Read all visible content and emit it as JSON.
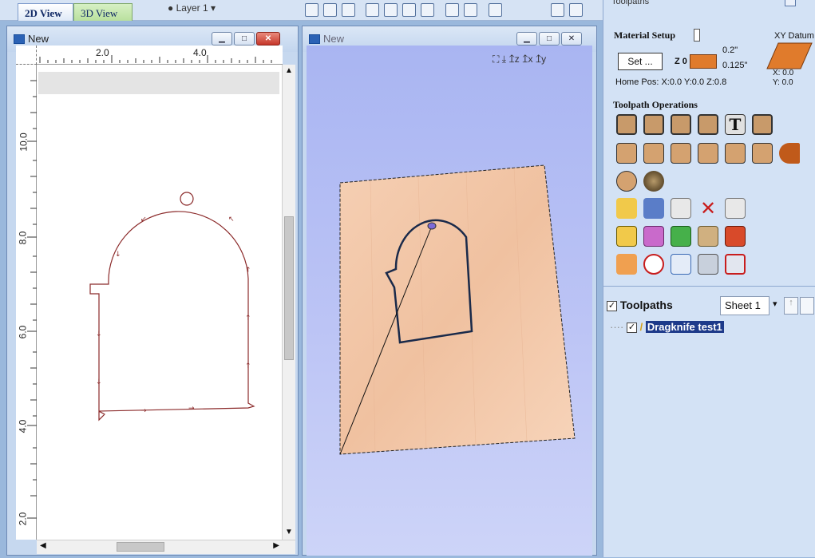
{
  "tabs": {
    "view2d": "2D View",
    "view3d": "3D View"
  },
  "layer_selector": "Layer 1",
  "window_2d": {
    "title": "New"
  },
  "window_3d": {
    "title": "New"
  },
  "ruler_top_labels": [
    "2.0",
    "4.0"
  ],
  "ruler_left_labels": [
    "10.0",
    "8.0",
    "6.0",
    "4.0",
    "2.0"
  ],
  "panel": {
    "header": "Toolpaths",
    "material_setup": "Material Setup",
    "set_button": "Set ...",
    "z_zero": "Z 0",
    "thickness_top": "0.2\"",
    "thickness_mid": "0.125\"",
    "home_pos": "Home Pos:  X:0.0 Y:0.0 Z:0.8",
    "xy_datum": "XY Datum",
    "datum_x": "X: 0.0",
    "datum_y": "Y: 0.0",
    "toolpath_operations": "Toolpath Operations",
    "toolpaths_label": "Toolpaths",
    "sheet_select": "Sheet 1",
    "toolpath_item": "Dragknife test1"
  },
  "colors": {
    "accent": "#2b62b5",
    "path2d": "#8b2a2a",
    "wood": "#f2c6a6",
    "panel_bg": "#d3e2f5"
  }
}
